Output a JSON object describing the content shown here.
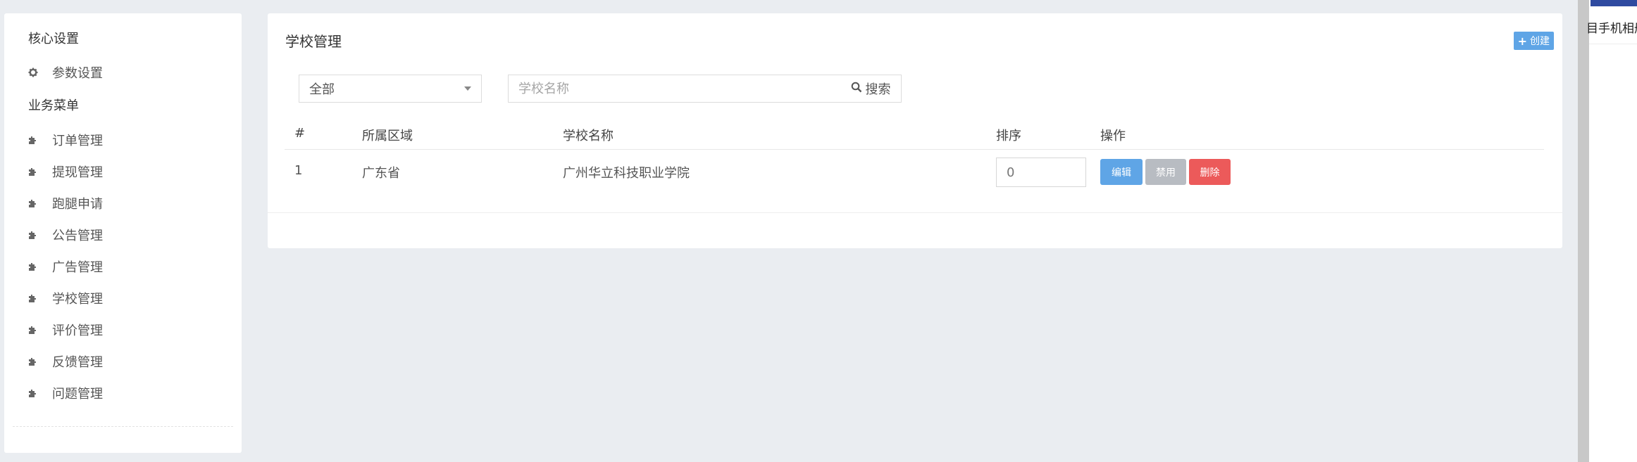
{
  "sidebar": {
    "section_core": "核心设置",
    "param_settings": "参数设置",
    "section_business": "业务菜单",
    "items": [
      {
        "label": "订单管理"
      },
      {
        "label": "提现管理"
      },
      {
        "label": "跑腿申请"
      },
      {
        "label": "公告管理"
      },
      {
        "label": "广告管理"
      },
      {
        "label": "学校管理"
      },
      {
        "label": "评价管理"
      },
      {
        "label": "反馈管理"
      },
      {
        "label": "问题管理"
      }
    ]
  },
  "main": {
    "title": "学校管理",
    "create_label": "创建",
    "filter": {
      "region_selected": "全部",
      "name_placeholder": "学校名称",
      "search_label": "搜索"
    },
    "table": {
      "headers": [
        "#",
        "所属区域",
        "学校名称",
        "排序",
        "操作"
      ],
      "rows": [
        {
          "index": "1",
          "region": "广东省",
          "name": "广州华立科技职业学院",
          "sort": "0"
        }
      ],
      "actions": {
        "edit": "编辑",
        "disable": "禁用",
        "delete": "删除"
      }
    }
  },
  "right_panel": {
    "text": "目手机相册"
  },
  "colors": {
    "primary": "#5fa5e6",
    "disabled": "#b8bcc2",
    "danger": "#ec5a5a",
    "background": "#eaedf1"
  }
}
